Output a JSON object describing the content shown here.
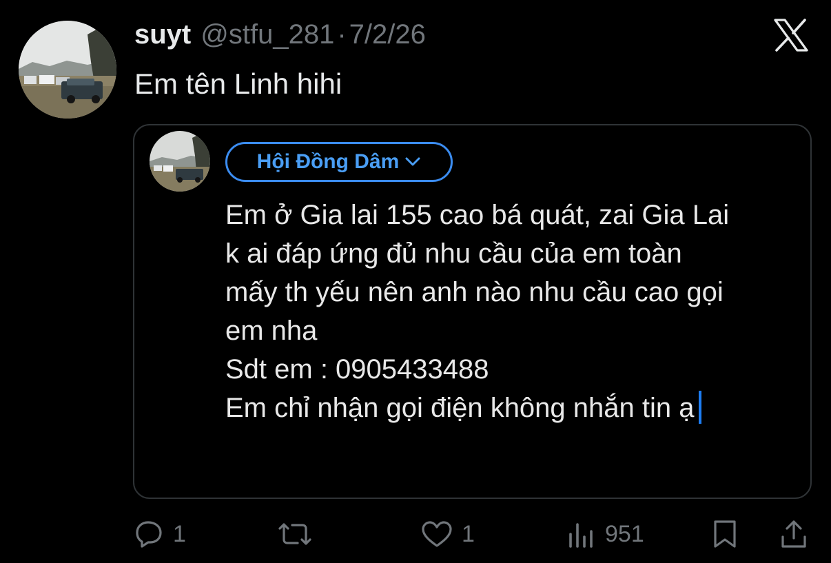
{
  "tweet": {
    "display_name": "suyt",
    "handle": "@stfu_281",
    "separator": "·",
    "date": "7/2/26",
    "text": "Em tên Linh hihi"
  },
  "quoted": {
    "group_name": "Hội Đồng Dâm",
    "lines": [
      "Em ở Gia lai 155 cao bá quát, zai Gia Lai",
      "k ai đáp ứng đủ nhu cầu của em toàn",
      "mấy th yếu nên anh nào nhu cầu cao gọi",
      "em nha",
      "Sdt em : 0905433488",
      "Em chỉ nhận gọi điện không nhắn tin ạ"
    ]
  },
  "actions": {
    "reply_count": "1",
    "retweet_count": "",
    "like_count": "1",
    "view_count": "951"
  },
  "icons": {
    "brand": "x-logo-icon",
    "reply": "reply-icon",
    "retweet": "retweet-icon",
    "like": "heart-icon",
    "views": "views-icon",
    "bookmark": "bookmark-icon",
    "share": "share-icon"
  },
  "colors": {
    "background": "#000000",
    "text": "#e7e9ea",
    "muted": "#71767b",
    "accent": "#3b8cf0",
    "border": "#2f3336"
  }
}
